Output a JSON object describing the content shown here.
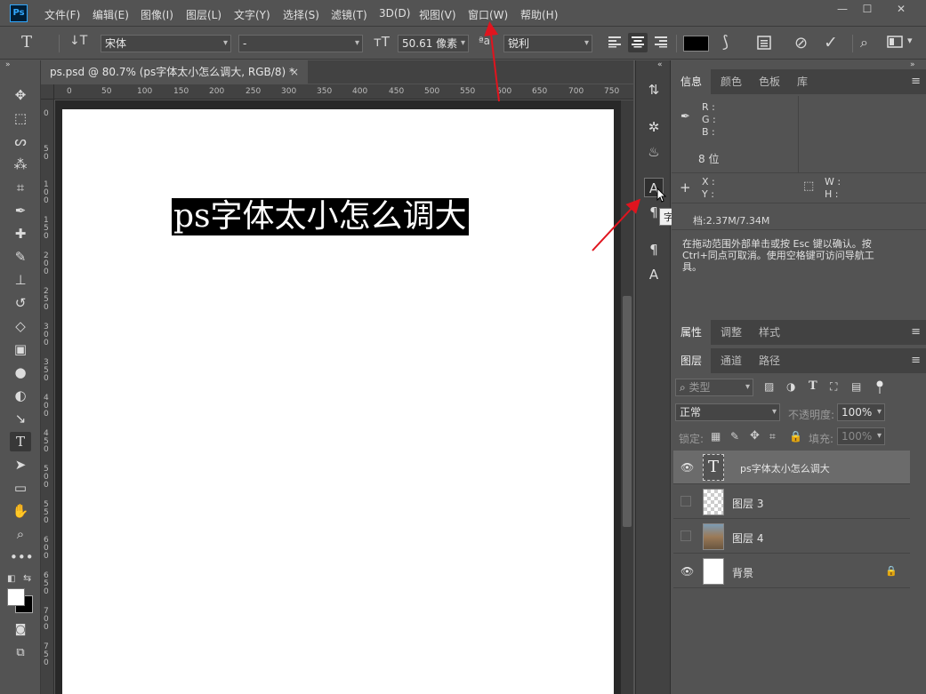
{
  "app": {
    "logo": "Ps"
  },
  "menu": [
    "文件(F)",
    "编辑(E)",
    "图像(I)",
    "图层(L)",
    "文字(Y)",
    "选择(S)",
    "滤镜(T)",
    "3D(D)",
    "视图(V)",
    "窗口(W)",
    "帮助(H)"
  ],
  "window_controls": [
    "—",
    "☐",
    "✕"
  ],
  "options": {
    "font_family": "宋体",
    "font_style": "-",
    "font_size": "50.61 像素",
    "aa_label": "ªa",
    "antialias": "锐利",
    "color": "#000000"
  },
  "document": {
    "tab_title": "ps.psd @ 80.7% (ps字体太小怎么调大, RGB/8) *",
    "tab_close": "×",
    "text": "ps字体太小怎么调大"
  },
  "ruler_top": [
    "0",
    "50",
    "100",
    "150",
    "200",
    "250",
    "300",
    "350",
    "400",
    "450",
    "500",
    "550",
    "600",
    "650",
    "700",
    "750"
  ],
  "ruler_left": [
    "0",
    "50",
    "100",
    "150",
    "200",
    "250",
    "300",
    "350",
    "400",
    "450",
    "500",
    "550",
    "600",
    "650",
    "700",
    "750"
  ],
  "dock": {
    "tooltip": "字符"
  },
  "info_panel": {
    "tabs": [
      "信息",
      "颜色",
      "色板",
      "库"
    ],
    "r": "R :",
    "g": "G :",
    "b": "B :",
    "bit": "8 位",
    "x": "X :",
    "y": "Y :",
    "w": "W :",
    "h": "H :",
    "doc": "档:2.37M/7.34M",
    "hint": "在拖动范围外部单击或按 Esc 键以确认。按 Ctrl+同点可取消。使用空格键可访问导航工具。"
  },
  "props_tabs": [
    "属性",
    "调整",
    "样式"
  ],
  "layers_panel": {
    "tabs": [
      "图层",
      "通道",
      "路径"
    ],
    "filter": "类型",
    "blend": "正常",
    "opacity_label": "不透明度:",
    "opacity": "100%",
    "lock_label": "锁定:",
    "fill_label": "填充:",
    "fill": "100%",
    "layers": [
      {
        "name": "ps字体太小怎么调大",
        "visible": true,
        "kind": "text"
      },
      {
        "name": "图层 3",
        "visible": false,
        "kind": "checker"
      },
      {
        "name": "图层 4",
        "visible": false,
        "kind": "photo"
      },
      {
        "name": "背景",
        "visible": true,
        "kind": "white"
      }
    ]
  },
  "colors": {
    "ps_blue": "#31a8ff",
    "arrow_red": "#e0141e",
    "panel": "#535353"
  }
}
